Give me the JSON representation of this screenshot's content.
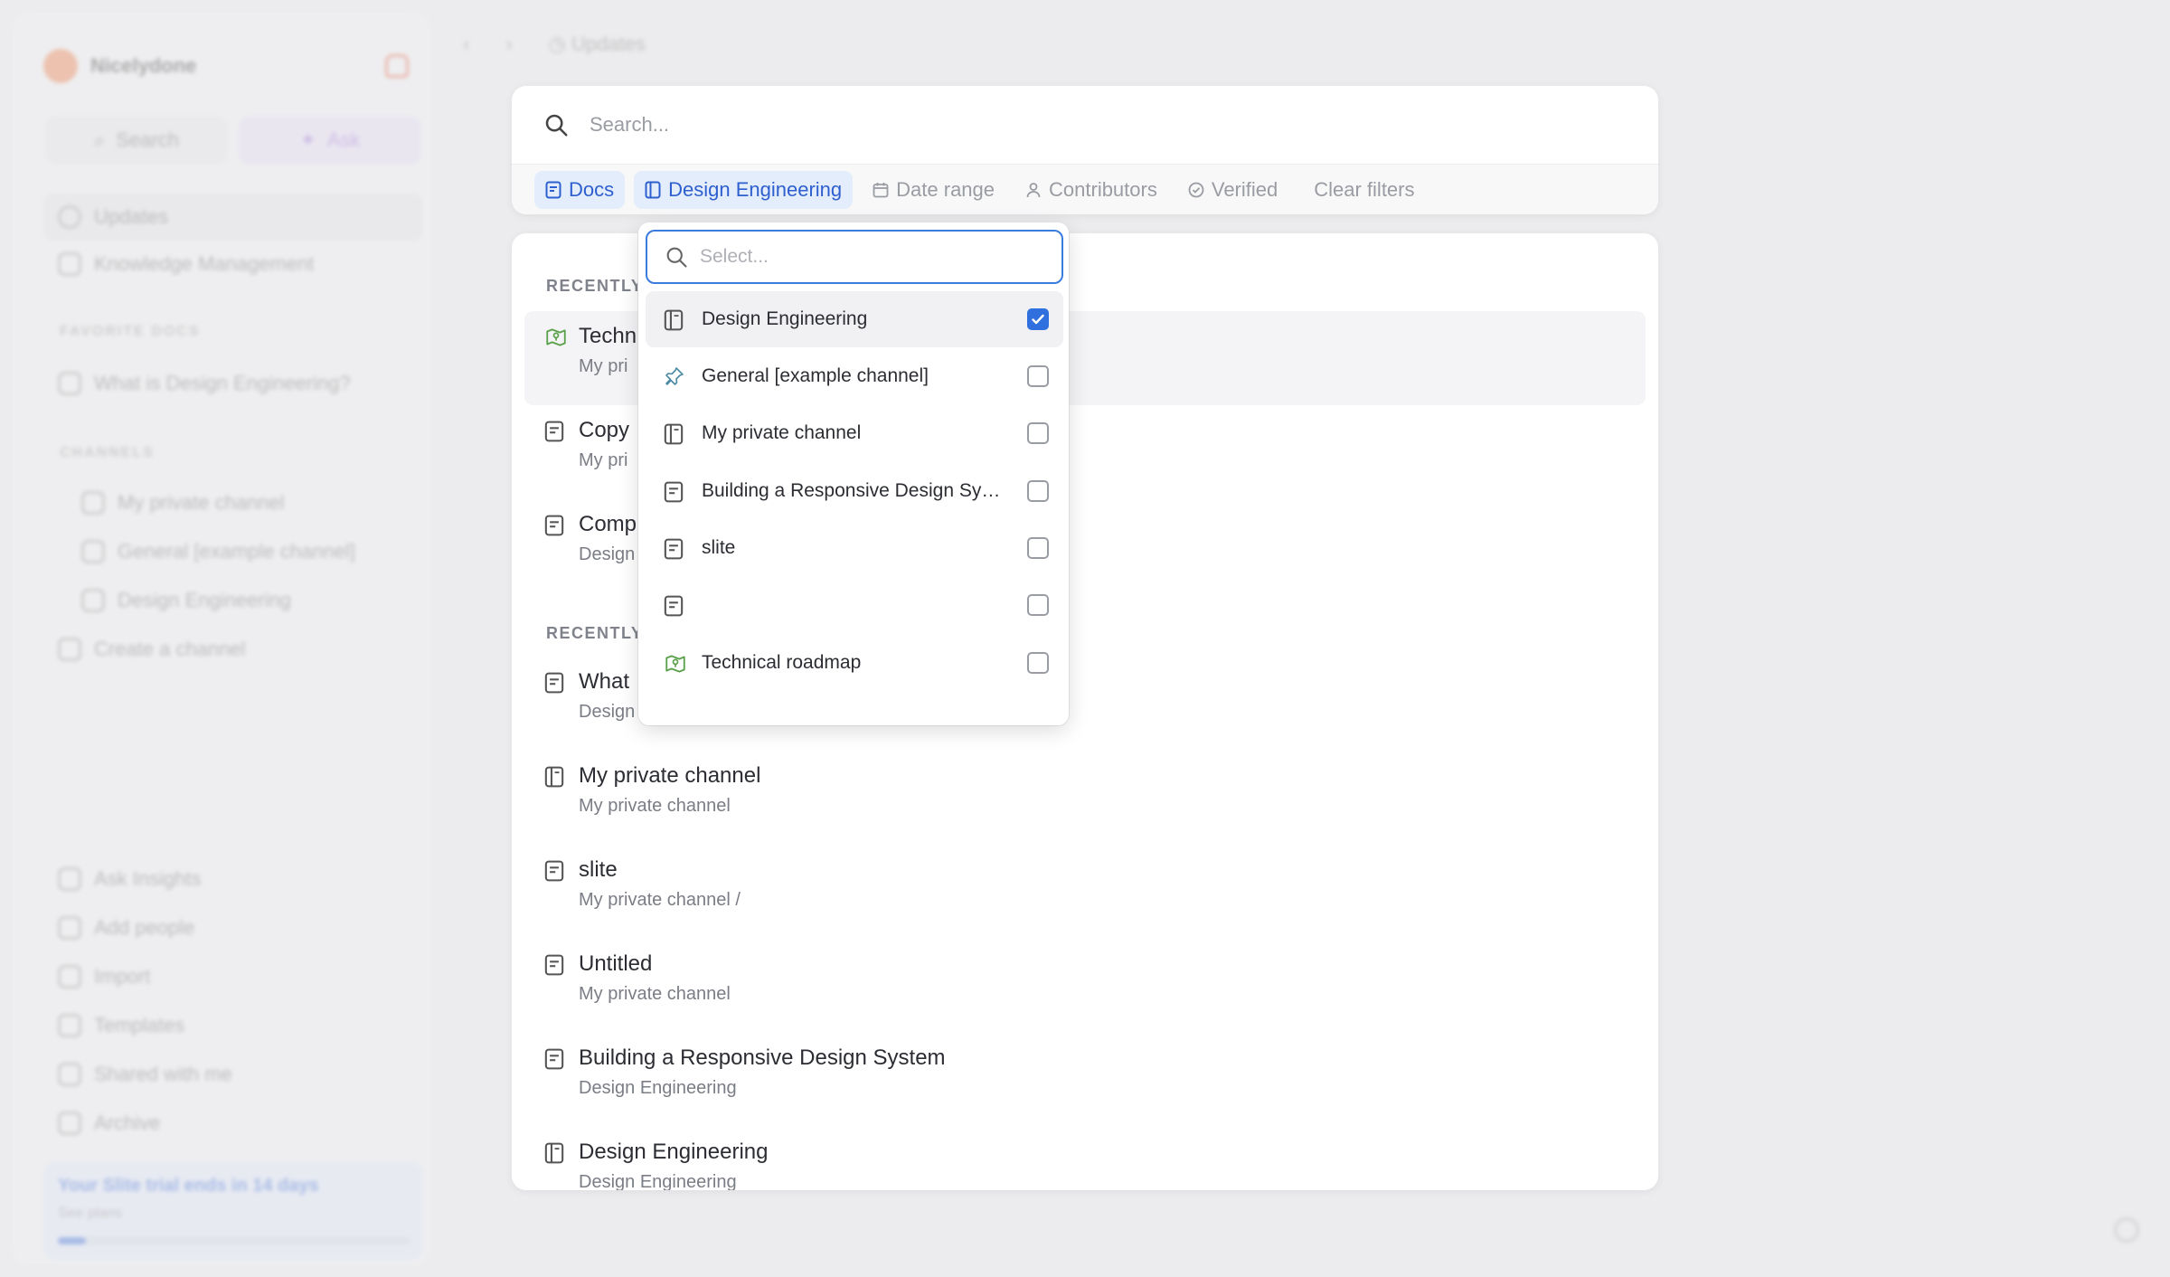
{
  "sidebar": {
    "workspace": "Nicelydone",
    "search_label": "Search",
    "ask_label": "Ask",
    "nav": [
      "Updates",
      "Knowledge Management"
    ],
    "favorites_heading": "FAVORITE DOCS",
    "favorites": [
      "What is Design Engineering?"
    ],
    "channels_heading": "CHANNELS",
    "channels": [
      "My private channel",
      "General [example channel]",
      "Design Engineering"
    ],
    "create_channel": "Create a channel",
    "bottom": [
      "Ask Insights",
      "Add people",
      "Import",
      "Templates",
      "Shared with me",
      "Archive"
    ],
    "trial_text": "Your Slite trial ends in 14 days",
    "trial_sub": "See plans",
    "trial_progress": 0.08
  },
  "topnav": {
    "breadcrumb": "Updates"
  },
  "search": {
    "placeholder": "Search...",
    "filters": {
      "docs": "Docs",
      "channel": "Design Engineering",
      "date_range": "Date range",
      "contributors": "Contributors",
      "verified": "Verified",
      "clear": "Clear filters"
    }
  },
  "results": {
    "section1": "RECENTLY",
    "section2": "RECENTLY",
    "items": [
      {
        "title": "Techni",
        "sub": "My pri",
        "icon": "roadmap-icon"
      },
      {
        "title": "Copy",
        "sub": "My pri",
        "icon": "doc-icon"
      },
      {
        "title": "Comp",
        "sub": "Design",
        "icon": "doc-icon"
      },
      {
        "title": "What",
        "sub": "Design",
        "icon": "doc-icon"
      },
      {
        "title": "My private channel",
        "sub": "My private channel",
        "icon": "channel-icon"
      },
      {
        "title": "slite",
        "sub": "My private channel   /",
        "icon": "doc-icon"
      },
      {
        "title": "Untitled",
        "sub": "My private channel",
        "icon": "doc-icon"
      },
      {
        "title": "Building a Responsive Design System",
        "sub": "Design Engineering",
        "icon": "doc-icon"
      },
      {
        "title": "Design Engineering",
        "sub": "Design Engineering",
        "icon": "channel-icon"
      }
    ]
  },
  "dropdown": {
    "placeholder": "Select...",
    "items": [
      {
        "label": "Design Engineering",
        "checked": true,
        "icon": "channel-icon"
      },
      {
        "label": "General [example channel]",
        "checked": false,
        "icon": "pin-icon"
      },
      {
        "label": "My private channel",
        "checked": false,
        "icon": "channel-icon"
      },
      {
        "label": "Building a Responsive Design System",
        "checked": false,
        "icon": "doc-icon"
      },
      {
        "label": "slite",
        "checked": false,
        "icon": "doc-icon"
      },
      {
        "label": "",
        "checked": false,
        "icon": "doc-icon"
      },
      {
        "label": "Technical roadmap",
        "checked": false,
        "icon": "roadmap-icon"
      }
    ]
  },
  "colors": {
    "accent": "#2f6fde",
    "chip_bg": "#e4edfb",
    "roadmap": "#5ba04a",
    "brand": "#f07840"
  }
}
